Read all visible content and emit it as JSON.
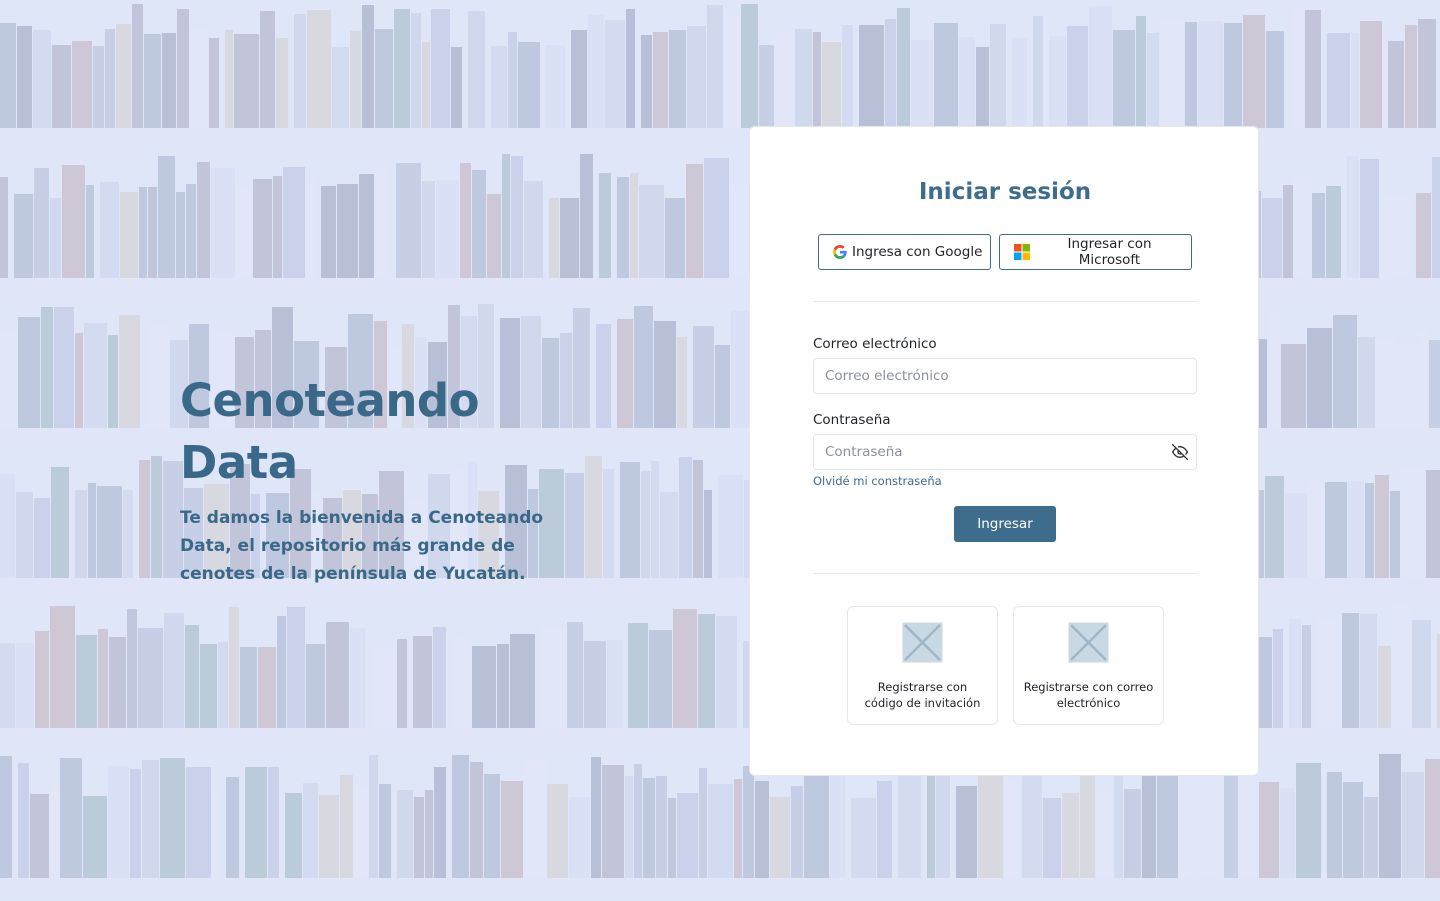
{
  "hero": {
    "title": "Cenoteando Data",
    "subtitle": "Te damos la bienvenida a Cenoteando Data, el repositorio más grande de cenotes de la península de Yucatán."
  },
  "login": {
    "title": "Iniciar sesión",
    "google_label": "Ingresa con Google",
    "microsoft_label": "Ingresar con Microsoft",
    "email_label": "Correo electrónico",
    "email_placeholder": "Correo electrónico",
    "email_value": "",
    "password_label": "Contraseña",
    "password_placeholder": "Contraseña",
    "password_value": "",
    "forgot_label": "Olvidé mi constraseña",
    "submit_label": "Ingresar"
  },
  "register": {
    "options": [
      {
        "label": "Registrarse con código de invitación",
        "icon": "image-placeholder-icon"
      },
      {
        "label": "Registrarse con correo electrónico",
        "icon": "image-placeholder-icon"
      }
    ]
  },
  "icons": {
    "google": "google-logo-icon",
    "microsoft": "microsoft-logo-icon",
    "password_toggle": "eye-off-icon"
  },
  "colors": {
    "primary": "#3e6c8d",
    "background": "#dfe6f5",
    "card": "#ffffff"
  }
}
